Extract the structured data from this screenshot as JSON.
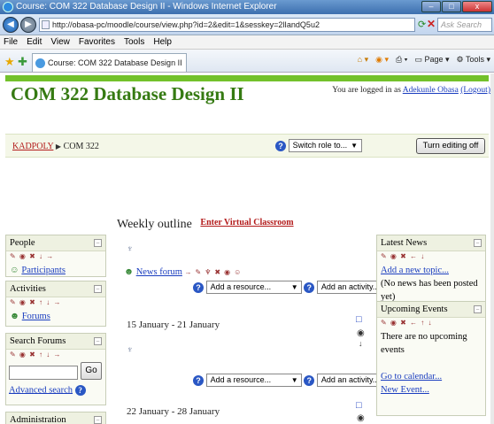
{
  "window": {
    "title": "Course: COM 322 Database Design II - Windows Internet Explorer"
  },
  "addressbar": {
    "url": "http://obasa-pc/moodle/course/view.php?id=2&edit=1&sesskey=2lIandQ5u2",
    "search_placeholder": "Ask Search"
  },
  "menu": [
    "File",
    "Edit",
    "View",
    "Favorites",
    "Tools",
    "Help"
  ],
  "tab": {
    "label": "Course: COM 322 Database Design II"
  },
  "toolbar_right": {
    "page": "Page",
    "tools": "Tools"
  },
  "header": {
    "course_title": "COM 322 Database Design II",
    "login_prefix": "You are logged in as",
    "user": "Adekunle Obasa",
    "logout": "(Logout)"
  },
  "breadcrumb": {
    "home": "KADPOLY",
    "current": "COM 322"
  },
  "controls": {
    "switch_role": "Switch role to...",
    "turn_editing": "Turn editing off"
  },
  "virtual_classroom": "Enter Virtual Classroom",
  "blocks_left": {
    "people": {
      "title": "People",
      "link": "Participants"
    },
    "activities": {
      "title": "Activities",
      "link": "Forums"
    },
    "search": {
      "title": "Search Forums",
      "button": "Go",
      "advanced": "Advanced search"
    },
    "admin": {
      "title": "Administration"
    }
  },
  "main": {
    "heading": "Weekly outline",
    "news_forum": "News forum",
    "add_resource": "Add a resource...",
    "add_activity": "Add an activity...",
    "weeks": [
      "15 January - 21 January",
      "22 January - 28 January"
    ]
  },
  "blocks_right": {
    "news": {
      "title": "Latest News",
      "add_topic": "Add a new topic...",
      "empty": "(No news has been posted yet)"
    },
    "events": {
      "title": "Upcoming Events",
      "empty": "There are no upcoming events",
      "calendar": "Go to calendar...",
      "new_event": "New Event..."
    }
  }
}
